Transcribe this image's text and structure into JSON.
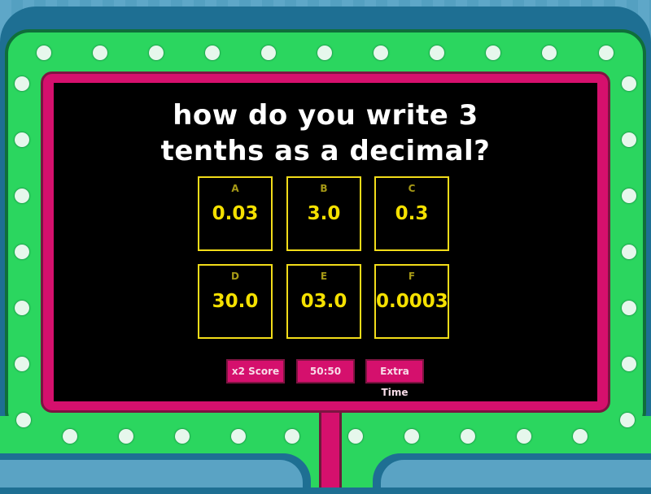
{
  "question": {
    "line1": "how do you write 3",
    "line2": "tenths as a decimal?"
  },
  "answers": [
    {
      "letter": "A",
      "value": "0.03"
    },
    {
      "letter": "B",
      "value": "3.0"
    },
    {
      "letter": "C",
      "value": "0.3"
    },
    {
      "letter": "D",
      "value": "30.0"
    },
    {
      "letter": "E",
      "value": "03.0"
    },
    {
      "letter": "F",
      "value": "0.0003"
    }
  ],
  "lifelines": {
    "double_score": "x2 Score",
    "fifty_fifty": "50:50",
    "extra_time": "Extra Time"
  },
  "colors": {
    "frame_green": "#2bd65f",
    "frame_pink": "#d5106d",
    "answer_yellow": "#f4e000",
    "background_blue": "#5aa3c4"
  }
}
